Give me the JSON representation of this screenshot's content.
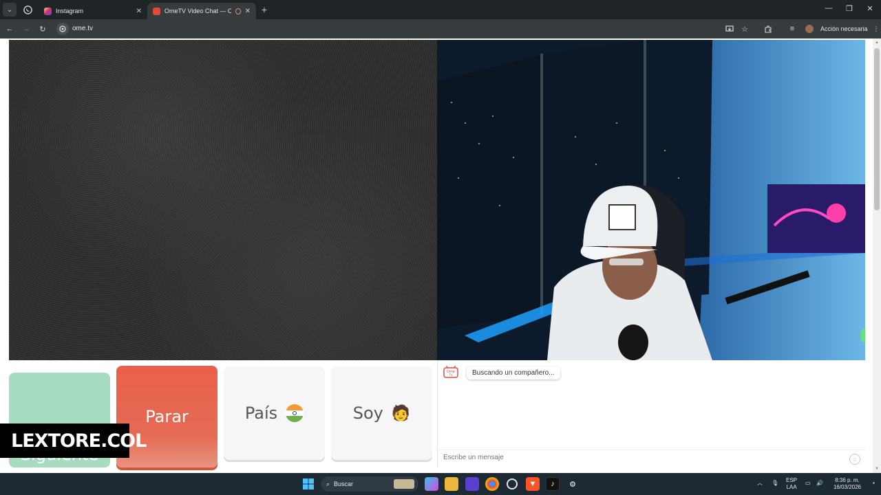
{
  "browser": {
    "tabs": [
      {
        "title": "Instagram",
        "active": false
      },
      {
        "title": "OmeTV Video Chat — Ome",
        "active": true
      }
    ],
    "url": "ome.tv",
    "action_button": "Acción necesaria"
  },
  "controls": {
    "next_label": "Siguiente",
    "stop_label": "Parar",
    "country_label": "País",
    "gender_label": "Soy",
    "gender_emoji": "🧑"
  },
  "chat": {
    "logo_text": "Ome TV",
    "status_message": "Buscando un compañero...",
    "input_placeholder": "Escribe un mensaje"
  },
  "watermark": {
    "text": "LEXTORE.COL"
  },
  "taskbar": {
    "search_label": "Buscar",
    "lang_top": "ESP",
    "lang_bottom": "LAA",
    "time": "8:36 p. m.",
    "date": "16/03/2026"
  },
  "colors": {
    "next_button": "#a7dcc0",
    "stop_button": "#e8604a",
    "neutral_button": "#f6f6f6"
  }
}
